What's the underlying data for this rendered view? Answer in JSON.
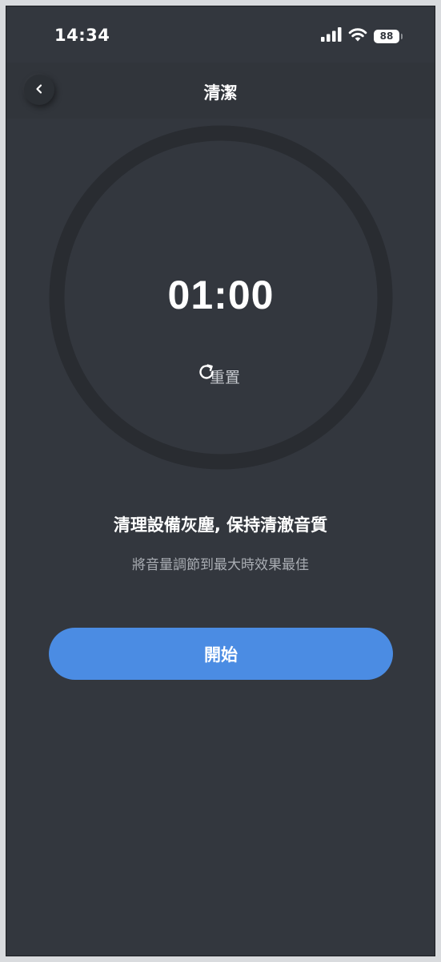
{
  "status_bar": {
    "time": "14:34",
    "battery_percent": "88",
    "battery_level": 0.88,
    "icons": [
      "signal-icon",
      "wifi-icon",
      "battery-icon"
    ]
  },
  "header": {
    "title": "清潔",
    "back_icon": "chevron-left-icon"
  },
  "timer": {
    "time": "01:00",
    "progress": 0,
    "reset_label": "重置",
    "reset_icon": "refresh-icon"
  },
  "description": {
    "title": "清理設備灰塵, 保持清澈音質",
    "subtitle": "將音量調節到最大時效果最佳"
  },
  "actions": {
    "start_label": "開始"
  },
  "colors": {
    "background": "#33373e",
    "ring": "#292c31",
    "accent": "#4b8ce3",
    "text_primary": "#ffffff",
    "text_secondary": "#a9adb3"
  }
}
